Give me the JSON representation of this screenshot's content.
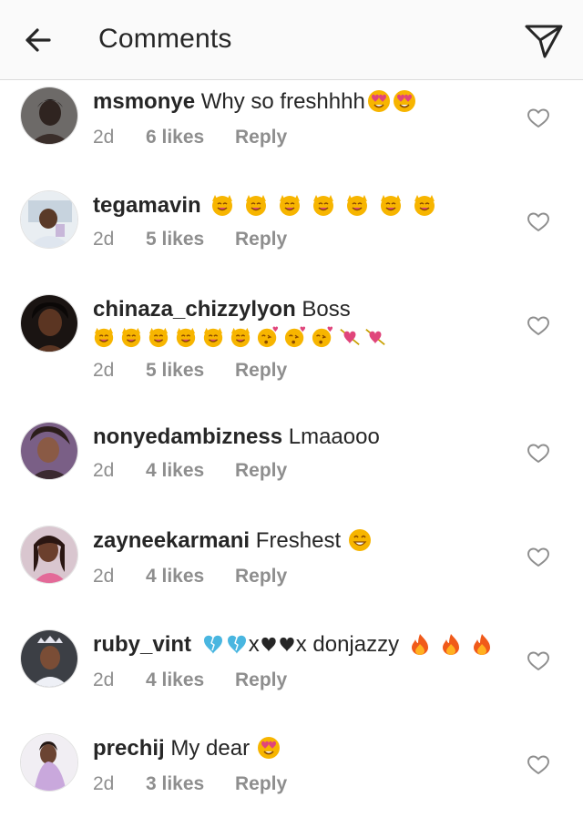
{
  "header": {
    "title": "Comments",
    "back_icon": "arrow-left-icon",
    "send_icon": "paper-plane-icon"
  },
  "colors": {
    "meta_gray": "#8e8e8e",
    "text": "#262626",
    "header_bg": "#fafafa",
    "emoji_yellow": "#f7b500",
    "heart_pink": "#e0457b",
    "blue_heart": "#49b6e0",
    "fire": "#f05a1a"
  },
  "comments": [
    {
      "username": "msmonye",
      "text": "Why so freshhhh",
      "emojis": [
        "heart-eyes-face",
        "heart-eyes-face"
      ],
      "age": "2d",
      "likes": "6 likes",
      "reply": "Reply"
    },
    {
      "username": "tegamavin",
      "text": "",
      "emojis": [
        "raising-hands-face",
        "raising-hands-face",
        "raising-hands-face",
        "raising-hands-face",
        "raising-hands-face",
        "raising-hands-face",
        "raising-hands-face"
      ],
      "age": "2d",
      "likes": "5 likes",
      "reply": "Reply"
    },
    {
      "username": "chinaza_chizzylyon",
      "text": "Boss",
      "emojis": [
        "raising-hands-face",
        "raising-hands-face",
        "raising-hands-face",
        "raising-hands-face",
        "raising-hands-face",
        "raising-hands-face",
        "kissing-heart-face",
        "kissing-heart-face",
        "kissing-heart-face",
        "heart-arrow",
        "heart-arrow"
      ],
      "age": "2d",
      "likes": "5 likes",
      "reply": "Reply"
    },
    {
      "username": "nonyedambizness",
      "text": "Lmaaooo",
      "emojis": [],
      "age": "2d",
      "likes": "4 likes",
      "reply": "Reply"
    },
    {
      "username": "zayneekarmani",
      "text": "Freshest",
      "emojis": [
        "grinning-face"
      ],
      "age": "2d",
      "likes": "4 likes",
      "reply": "Reply"
    },
    {
      "username": "ruby_vint",
      "text_part1": "x",
      "text_part2": "x donjazzy",
      "age": "2d",
      "likes": "4 likes",
      "reply": "Reply"
    },
    {
      "username": "prechij",
      "text": "My dear",
      "emojis": [
        "heart-eyes-face"
      ],
      "age": "2d",
      "likes": "3 likes",
      "reply": "Reply"
    }
  ]
}
